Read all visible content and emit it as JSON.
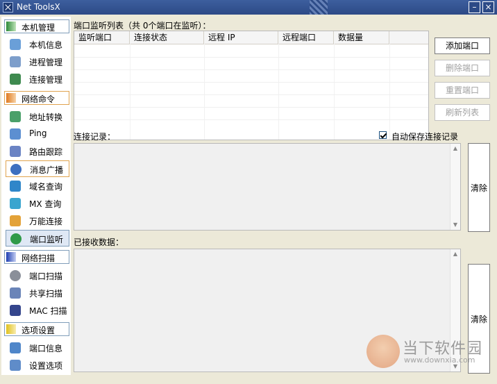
{
  "window": {
    "title": "Net ToolsX"
  },
  "sidebar": {
    "sections": [
      {
        "label": "本机管理",
        "color": "#2e8b3a"
      },
      {
        "label": "网络命令",
        "color": "#e07a1f"
      },
      {
        "label": "网络扫描",
        "color": "#1f3fb2"
      },
      {
        "label": "选项设置",
        "color": "#e0c21f"
      }
    ],
    "items": [
      {
        "label": "本机信息",
        "icon": "info-icon"
      },
      {
        "label": "进程管理",
        "icon": "process-icon"
      },
      {
        "label": "连接管理",
        "icon": "connection-icon"
      },
      {
        "label": "地址转换",
        "icon": "address-icon"
      },
      {
        "label": "Ping",
        "icon": "ping-icon"
      },
      {
        "label": "路由跟踪",
        "icon": "route-icon"
      },
      {
        "label": "消息广播",
        "icon": "broadcast-icon"
      },
      {
        "label": "域名查询",
        "icon": "domain-icon"
      },
      {
        "label": "MX 查询",
        "icon": "mx-icon"
      },
      {
        "label": "万能连接",
        "icon": "key-icon"
      },
      {
        "label": "端口监听",
        "icon": "listen-icon"
      },
      {
        "label": "端口扫描",
        "icon": "scan-icon"
      },
      {
        "label": "共享扫描",
        "icon": "share-icon"
      },
      {
        "label": "MAC 扫描",
        "icon": "mac-icon"
      },
      {
        "label": "端口信息",
        "icon": "portinfo-icon"
      },
      {
        "label": "设置选项",
        "icon": "settings-icon"
      }
    ]
  },
  "listener": {
    "title": "端口监听列表（共 0个端口在监听）：",
    "columns": [
      "监听端口",
      "连接状态",
      "远程 IP",
      "远程端口",
      "数据量"
    ],
    "buttons": {
      "add": "添加端口",
      "remove": "删除端口",
      "reset": "重置端口",
      "refresh": "刷新列表"
    }
  },
  "connections": {
    "label": "连接记录：",
    "autosave_label": "自动保存连接记录",
    "autosave_checked": true,
    "clear": "清除"
  },
  "received": {
    "label": "已接收数据：",
    "clear": "清除"
  },
  "watermark": {
    "name": "当下软件园",
    "url": "www.downxia.com"
  }
}
